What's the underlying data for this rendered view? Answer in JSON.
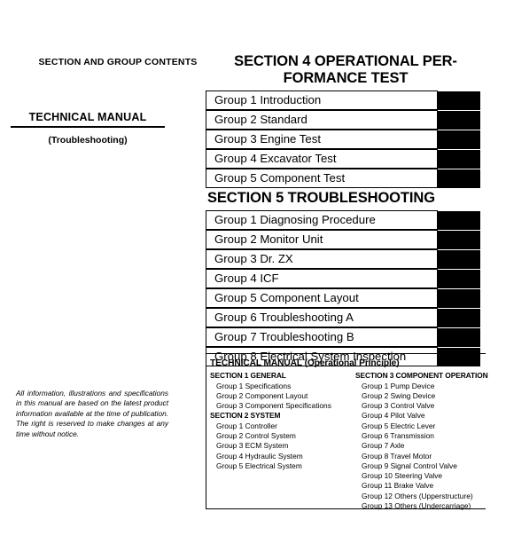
{
  "left": {
    "contents_heading": "SECTION AND GROUP CONTENTS",
    "tech_manual_title": "TECHNICAL MANUAL",
    "tech_manual_sub": "(Troubleshooting)",
    "disclaimer": "All information, illustrations and specifications in this manual are based on the latest product information available at the time of publication. The right is reserved to make changes at any time without notice."
  },
  "section4": {
    "title": "SECTION 4 OPERATIONAL PER-FORMANCE TEST",
    "title_line1": "SECTION 4 OPERATIONAL PER-",
    "title_line2": "FORMANCE TEST",
    "rows": [
      {
        "label": "Group 1 Introduction",
        "tab": true
      },
      {
        "label": "Group 2 Standard",
        "tab": true
      },
      {
        "label": "Group 3 Engine Test",
        "tab": true
      },
      {
        "label": "Group 4 Excavator Test",
        "tab": true
      },
      {
        "label": "Group 5 Component Test",
        "tab": true
      }
    ]
  },
  "section5": {
    "title": "SECTION 5 TROUBLESHOOTING",
    "rows": [
      {
        "label": "Group 1 Diagnosing Procedure",
        "tab": true
      },
      {
        "label": "Group 2 Monitor Unit",
        "tab": true
      },
      {
        "label": "Group 3 Dr. ZX",
        "tab": true
      },
      {
        "label": "Group 4 ICF",
        "tab": true
      },
      {
        "label": "Group 5 Component Layout",
        "tab": true
      },
      {
        "label": "Group 6 Troubleshooting A",
        "tab": true
      },
      {
        "label": "Group 7 Troubleshooting B",
        "tab": true
      },
      {
        "label": "Group 8 Electrical System Inspection",
        "tab": true
      }
    ]
  },
  "operational_principle": {
    "title": "TECHNICAL MANUAL (Operational Principle)",
    "left_column": [
      {
        "type": "head",
        "label": "SECTION 1 GENERAL"
      },
      {
        "type": "item",
        "label": "Group 1 Specifications"
      },
      {
        "type": "item",
        "label": "Group 2 Component Layout"
      },
      {
        "type": "item",
        "label": "Group 3 Component Specifications"
      },
      {
        "type": "head",
        "label": "SECTION 2 SYSTEM"
      },
      {
        "type": "item",
        "label": "Group 1 Controller"
      },
      {
        "type": "item",
        "label": "Group 2 Control System"
      },
      {
        "type": "item",
        "label": "Group 3 ECM System"
      },
      {
        "type": "item",
        "label": "Group 4 Hydraulic System"
      },
      {
        "type": "item",
        "label": "Group 5 Electrical System"
      }
    ],
    "right_column": [
      {
        "type": "head",
        "label": "SECTION 3 COMPONENT OPERATION"
      },
      {
        "type": "item",
        "label": "Group 1 Pump Device"
      },
      {
        "type": "item",
        "label": "Group 2 Swing Device"
      },
      {
        "type": "item",
        "label": "Group 3 Control Valve"
      },
      {
        "type": "item",
        "label": "Group 4 Pilot Valve"
      },
      {
        "type": "item",
        "label": "Group 5 Electric Lever"
      },
      {
        "type": "item",
        "label": "Group 6 Transmission"
      },
      {
        "type": "item",
        "label": "Group 7 Axle"
      },
      {
        "type": "item",
        "label": "Group 8 Travel Motor"
      },
      {
        "type": "item",
        "label": "Group 9 Signal Control Valve"
      },
      {
        "type": "item",
        "label": "Group 10 Steering Valve"
      },
      {
        "type": "item",
        "label": "Group 11 Brake Valve"
      },
      {
        "type": "item",
        "label": "Group 12 Others (Upperstructure)"
      },
      {
        "type": "item",
        "label": "Group 13 Others (Undercarriage)"
      }
    ]
  },
  "colors": {
    "ink": "#000000",
    "paper": "#ffffff",
    "tab_mark": "#000000"
  }
}
